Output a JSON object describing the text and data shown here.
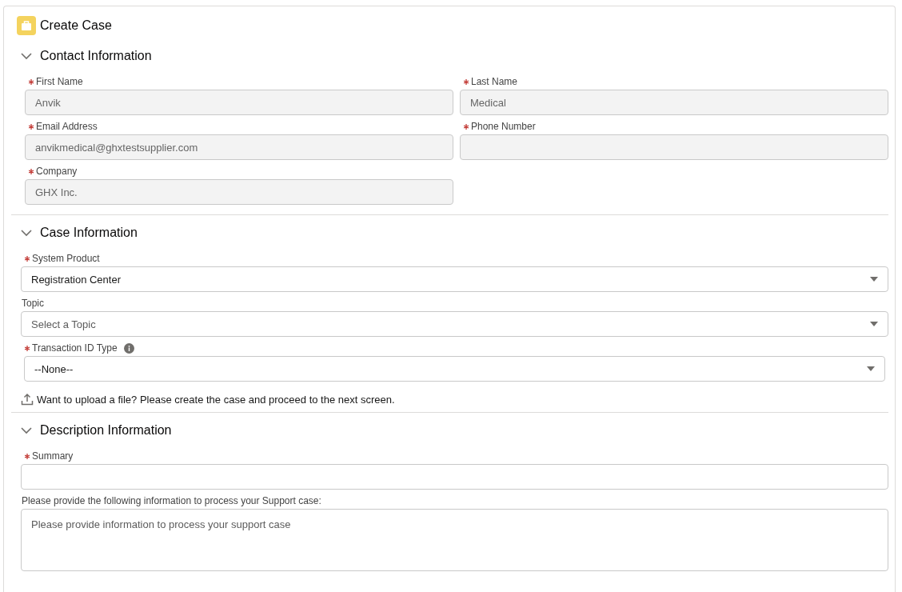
{
  "card": {
    "title": "Create Case"
  },
  "sections": [
    {
      "title": "Contact Information",
      "expanded": true,
      "kind": "two-column",
      "fields": [
        {
          "kind": "text",
          "label": "First Name",
          "required": true,
          "disabled": true,
          "value": "Anvik"
        },
        {
          "kind": "text",
          "label": "Last Name",
          "required": true,
          "disabled": true,
          "value": "Medical"
        },
        {
          "kind": "text",
          "label": "Email Address",
          "required": true,
          "disabled": true,
          "value": "anvikmedical@ghxtestsupplier.com"
        },
        {
          "kind": "text",
          "label": "Phone Number",
          "required": true,
          "disabled": true
        },
        {
          "kind": "text",
          "label": "Company",
          "required": true,
          "disabled": true,
          "value": "GHX Inc."
        }
      ]
    },
    {
      "title": "Case Information",
      "expanded": true,
      "kind": "single-column",
      "fields": [
        {
          "kind": "select",
          "label": "System Product",
          "required": true,
          "value": "Registration Center"
        },
        {
          "kind": "select",
          "label": "Topic",
          "required": false,
          "placeholder": "Select a Topic"
        },
        {
          "kind": "select",
          "label": "Transaction ID Type",
          "required": true,
          "info": true,
          "value": "--None--"
        },
        {
          "kind": "note",
          "text": "Want to upload a file? Please create the case and proceed to the next screen."
        }
      ]
    },
    {
      "title": "Description Information",
      "expanded": true,
      "kind": "single-column",
      "fields": [
        {
          "kind": "text",
          "label": "Summary",
          "required": true,
          "disabled": false
        },
        {
          "kind": "textarea",
          "label": "Please provide the following information to process your Support case:",
          "required": false,
          "placeholder": "Please provide information to process your support case"
        }
      ]
    }
  ]
}
